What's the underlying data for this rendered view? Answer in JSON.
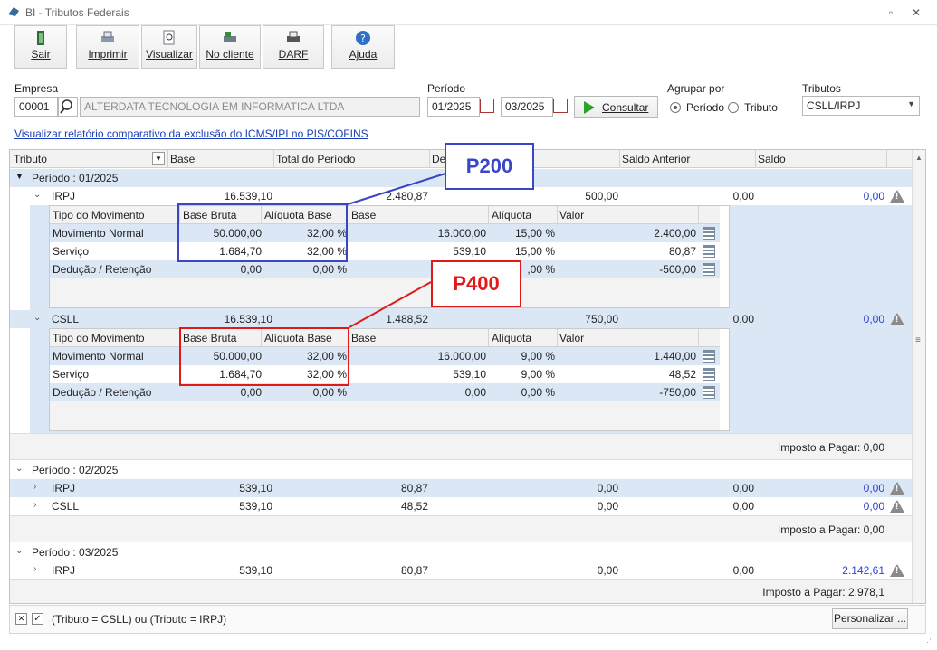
{
  "window": {
    "title": "BI - Tributos Federais"
  },
  "toolbar": {
    "sair": "Sair",
    "imprimir": "Imprimir",
    "visualizar": "Visualizar",
    "no_cliente": "No cliente",
    "darf": "DARF",
    "ajuda": "Ajuda"
  },
  "filters": {
    "empresa_label": "Empresa",
    "empresa_code": "00001",
    "empresa_name": "ALTERDATA TECNOLOGIA EM INFORMATICA LTDA",
    "periodo_label": "Período",
    "periodo_start": "01/2025",
    "periodo_end": "03/2025",
    "consultar": "Consultar",
    "agrupar_label": "Agrupar por",
    "agrupar_periodo": "Período",
    "agrupar_tributo": "Tributo",
    "tributos_label": "Tributos",
    "tributos_value": "CSLL/IRPJ",
    "comparativo_link": "Visualizar relatório comparativo da exclusão do ICMS/IPI no PIS/COFINS"
  },
  "grid": {
    "headers": [
      "Tributo",
      "Base",
      "Total do Período",
      "De",
      "Saldo Anterior",
      "Saldo"
    ],
    "sub_headers": [
      "Tipo do Movimento",
      "Base Bruta",
      "Alíquota Base",
      "Base",
      "Alíquota",
      "Valor"
    ],
    "p1": {
      "label": "Período : 01/2025",
      "irpj": {
        "name": "IRPJ",
        "base": "16.539,10",
        "total": "2.480,87",
        "col4": "500,00",
        "saldo_ant": "0,00",
        "saldo": "0,00"
      },
      "irpj_rows": [
        {
          "tipo": "Movimento Normal",
          "bb": "50.000,00",
          "ab": "32,00 %",
          "base": "16.000,00",
          "aliq": "15,00 %",
          "valor": "2.400,00"
        },
        {
          "tipo": "Serviço",
          "bb": "1.684,70",
          "ab": "32,00 %",
          "base": "539,10",
          "aliq": "15,00 %",
          "valor": "80,87"
        },
        {
          "tipo": "Dedução / Retenção",
          "bb": "0,00",
          "ab": "0,00 %",
          "base": "",
          "aliq": ",00 %",
          "valor": "-500,00"
        }
      ],
      "csll": {
        "name": "CSLL",
        "base": "16.539,10",
        "total": "1.488,52",
        "col4": "750,00",
        "saldo_ant": "0,00",
        "saldo": "0,00"
      },
      "csll_rows": [
        {
          "tipo": "Movimento Normal",
          "bb": "50.000,00",
          "ab": "32,00 %",
          "base": "16.000,00",
          "aliq": "9,00 %",
          "valor": "1.440,00"
        },
        {
          "tipo": "Serviço",
          "bb": "1.684,70",
          "ab": "32,00 %",
          "base": "539,10",
          "aliq": "9,00 %",
          "valor": "48,52"
        },
        {
          "tipo": "Dedução / Retenção",
          "bb": "0,00",
          "ab": "0,00 %",
          "base": "0,00",
          "aliq": "0,00 %",
          "valor": "-750,00"
        }
      ],
      "imposto": "Imposto a Pagar: 0,00"
    },
    "p2": {
      "label": "Período : 02/2025",
      "irpj": {
        "name": "IRPJ",
        "base": "539,10",
        "total": "80,87",
        "col4": "0,00",
        "saldo_ant": "0,00",
        "saldo": "0,00"
      },
      "csll": {
        "name": "CSLL",
        "base": "539,10",
        "total": "48,52",
        "col4": "0,00",
        "saldo_ant": "0,00",
        "saldo": "0,00"
      },
      "imposto": "Imposto a Pagar: 0,00"
    },
    "p3": {
      "label": "Período : 03/2025",
      "irpj": {
        "name": "IRPJ",
        "base": "539,10",
        "total": "80,87",
        "col4": "0,00",
        "saldo_ant": "0,00",
        "saldo": "2.142,61"
      },
      "imposto": "Imposto a Pagar: 2.978,1"
    }
  },
  "annotations": {
    "p200": "P200",
    "p400": "P400"
  },
  "footer": {
    "filter_text": "(Tributo = CSLL) ou (Tributo = IRPJ)",
    "personalizar": "Personalizar ..."
  },
  "colors": {
    "blue_box": "#3a46c6",
    "red_box": "#e01919",
    "link": "#1a3fb8",
    "saldo_blue": "#2b3fd6"
  }
}
